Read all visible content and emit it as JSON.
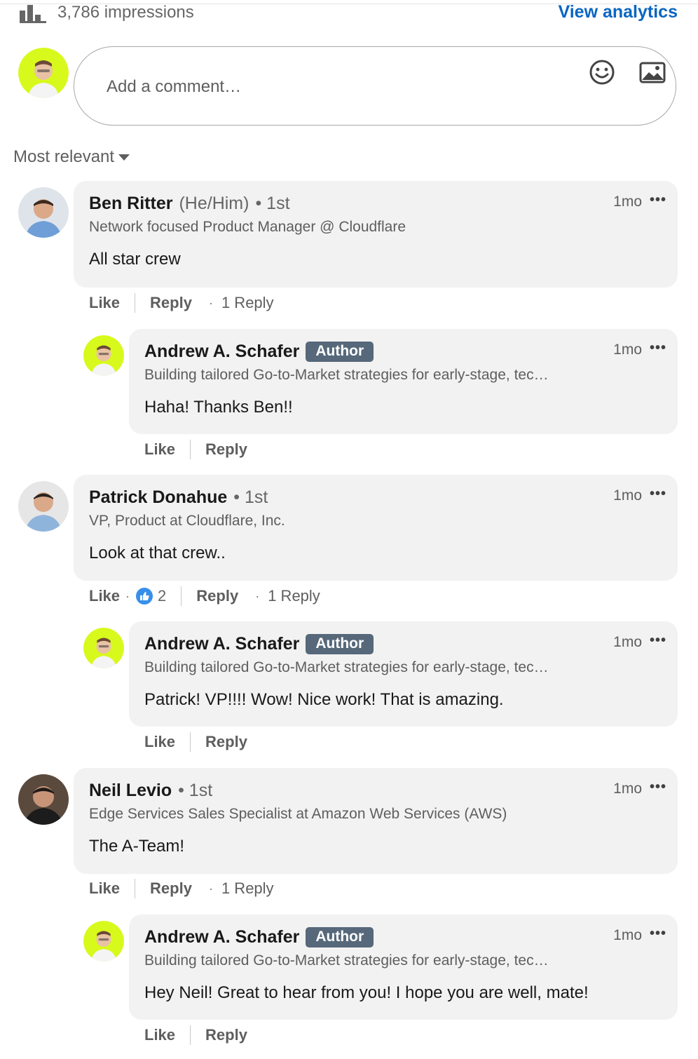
{
  "header": {
    "impressions": "3,786 impressions",
    "view_analytics": "View analytics"
  },
  "composer": {
    "placeholder": "Add a comment…"
  },
  "sort": {
    "label": "Most relevant"
  },
  "icons": {
    "emoji": "emoji-icon",
    "image": "image-icon",
    "analytics": "bar-chart-icon",
    "like": "thumbs-up-icon"
  },
  "colors": {
    "accent": "#0a66c2",
    "author_badge": "#56687a",
    "bubble": "#f2f2f2",
    "avatar_ring": "#d8f91c"
  },
  "comments": [
    {
      "name": "Ben Ritter",
      "pronouns": "(He/Him)",
      "degree": "• 1st",
      "headline": "Network focused Product Manager @ Cloudflare",
      "text": "All star crew",
      "time": "1mo",
      "like": "Like",
      "reply": "Reply",
      "replies": "1 Reply",
      "reply_item": {
        "name": "Andrew A. Schafer",
        "badge": "Author",
        "headline": "Building tailored Go-to-Market strategies for early-stage, tec…",
        "text": "Haha! Thanks Ben!!",
        "time": "1mo",
        "like": "Like",
        "reply": "Reply"
      }
    },
    {
      "name": "Patrick Donahue",
      "degree": "• 1st",
      "headline": "VP, Product at Cloudflare, Inc.",
      "text": "Look at that crew..",
      "time": "1mo",
      "like": "Like",
      "reaction_count": "2",
      "reply": "Reply",
      "replies": "1 Reply",
      "reply_item": {
        "name": "Andrew A. Schafer",
        "badge": "Author",
        "headline": "Building tailored Go-to-Market strategies for early-stage, tec…",
        "text": "Patrick! VP!!!! Wow! Nice work! That is amazing.",
        "time": "1mo",
        "like": "Like",
        "reply": "Reply"
      }
    },
    {
      "name": "Neil Levio",
      "degree": "• 1st",
      "headline": "Edge Services Sales Specialist at Amazon Web Services (AWS)",
      "text": "The A-Team!",
      "time": "1mo",
      "like": "Like",
      "reply": "Reply",
      "replies": "1 Reply",
      "reply_item": {
        "name": "Andrew A. Schafer",
        "badge": "Author",
        "headline": "Building tailored Go-to-Market strategies for early-stage, tec…",
        "text": "Hey Neil! Great to hear from you! I hope you are well, mate!",
        "time": "1mo",
        "like": "Like",
        "reply": "Reply"
      }
    }
  ]
}
